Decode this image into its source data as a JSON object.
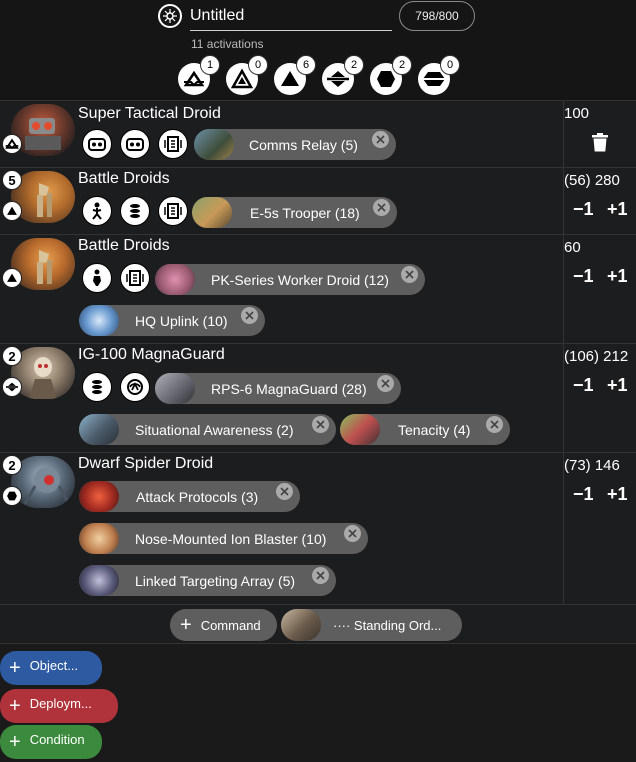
{
  "header": {
    "title": "Untitled",
    "points": "798/800",
    "activations": "11 activations",
    "ranks": [
      {
        "name": "commander",
        "count": "1"
      },
      {
        "name": "operative",
        "count": "0"
      },
      {
        "name": "corps",
        "count": "6"
      },
      {
        "name": "special-forces",
        "count": "2"
      },
      {
        "name": "support",
        "count": "2"
      },
      {
        "name": "heavy",
        "count": "0"
      }
    ]
  },
  "units": [
    {
      "count": "",
      "name": "Super Tactical Droid",
      "points": "100",
      "upgrades": [
        {
          "label": "Comms Relay (5)"
        }
      ]
    },
    {
      "count": "5",
      "name": "Battle Droids",
      "points": "(56) 280",
      "upgrades": [
        {
          "label": "E-5s Trooper (18)"
        }
      ]
    },
    {
      "count": "",
      "name": "Battle Droids",
      "points": "60",
      "upgrades": [
        {
          "label": "PK-Series Worker Droid (12)"
        },
        {
          "label": "HQ Uplink (10)"
        }
      ]
    },
    {
      "count": "2",
      "name": "IG-100 MagnaGuard",
      "points": "(106) 212",
      "upgrades": [
        {
          "label": "RPS-6 MagnaGuard (28)"
        },
        {
          "label": "Situational Awareness (2)"
        },
        {
          "label": "Tenacity (4)"
        }
      ]
    },
    {
      "count": "2",
      "name": "Dwarf Spider Droid",
      "points": "(73) 146",
      "upgrades": [
        {
          "label": "Attack Protocols (3)"
        },
        {
          "label": "Nose-Mounted Ion Blaster (10)"
        },
        {
          "label": "Linked Targeting Array (5)"
        }
      ]
    }
  ],
  "controls": {
    "minus": "−1",
    "plus": "+1"
  },
  "command_bar": {
    "command_label": "Command",
    "standing_orders_label": "···· Standing Ord..."
  },
  "cards": {
    "objective_label": "Object...",
    "deployment_label": "Deploym...",
    "condition_label": "Condition"
  },
  "colors": {
    "objective": "#2d5aa0",
    "deployment": "#b0323a",
    "condition": "#3b8a3d",
    "chip": "#5e5e5e"
  }
}
